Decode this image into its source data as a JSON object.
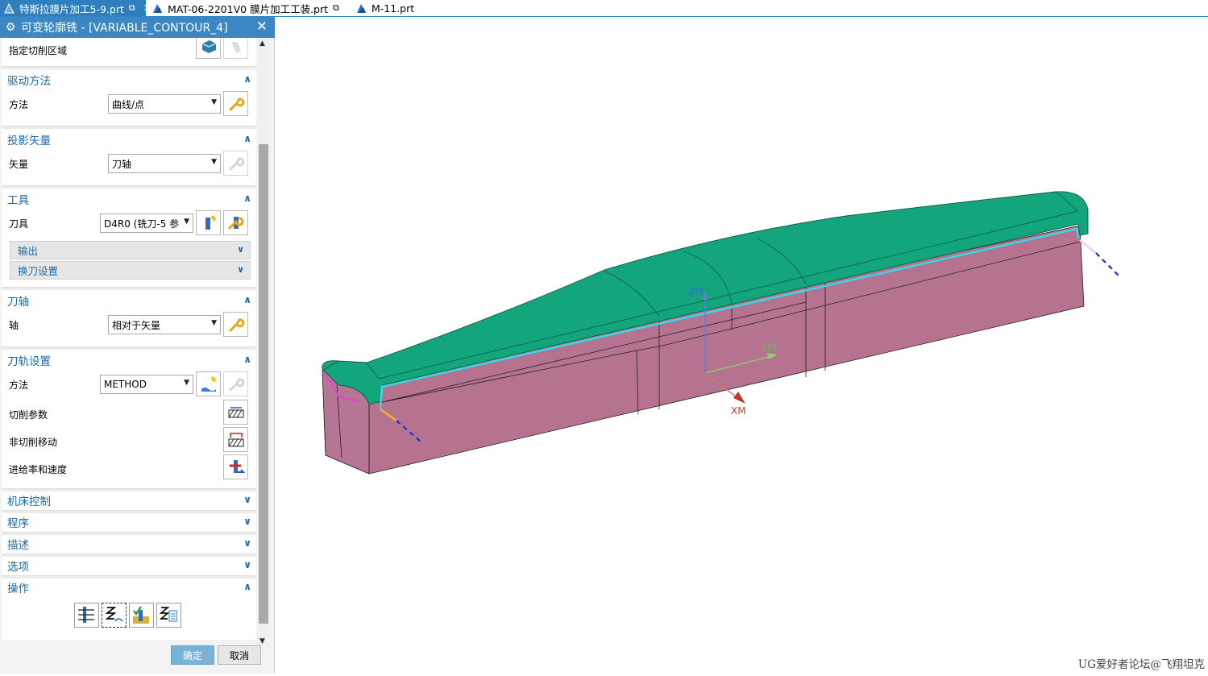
{
  "tabs": [
    {
      "label": "特斯拉膜片加工5-9.prt",
      "active": true
    },
    {
      "label": "MAT-06-2201V0 膜片加工工装.prt",
      "active": false
    },
    {
      "label": "M-11.prt",
      "active": false
    }
  ],
  "dialog": {
    "title": "可变轮廓铣 - [VARIABLE_CONTOUR_4]",
    "specify_cut_area": "指定切削区域",
    "drive": {
      "title": "驱动方法",
      "method_label": "方法",
      "method_value": "曲线/点"
    },
    "projection": {
      "title": "投影矢量",
      "vector_label": "矢量",
      "vector_value": "刀轴"
    },
    "tool": {
      "title": "工具",
      "tool_label": "刀具",
      "tool_value": "D4R0 (铣刀-5 参",
      "output": "输出",
      "tool_change": "换刀设置"
    },
    "axis": {
      "title": "刀轴",
      "axis_label": "轴",
      "axis_value": "相对于矢量"
    },
    "path": {
      "title": "刀轨设置",
      "method_label": "方法",
      "method_value": "METHOD",
      "cut_params": "切削参数",
      "non_cut_moves": "非切削移动",
      "feeds_speeds": "进给率和速度"
    },
    "collapsed": [
      "机床控制",
      "程序",
      "描述",
      "选项"
    ],
    "operations": {
      "title": "操作"
    },
    "ok": "确定",
    "cancel": "取消"
  },
  "viewport": {
    "axis_labels": {
      "zm": "ZM",
      "ym": "YM",
      "xm": "XM"
    },
    "watermark": "UG爱好者论坛@飞翔坦克"
  },
  "colors": {
    "accent": "#3d86c4",
    "part_top": "#13a67c",
    "part_side": "#b5738f",
    "toolpath": "#38d6e6"
  }
}
